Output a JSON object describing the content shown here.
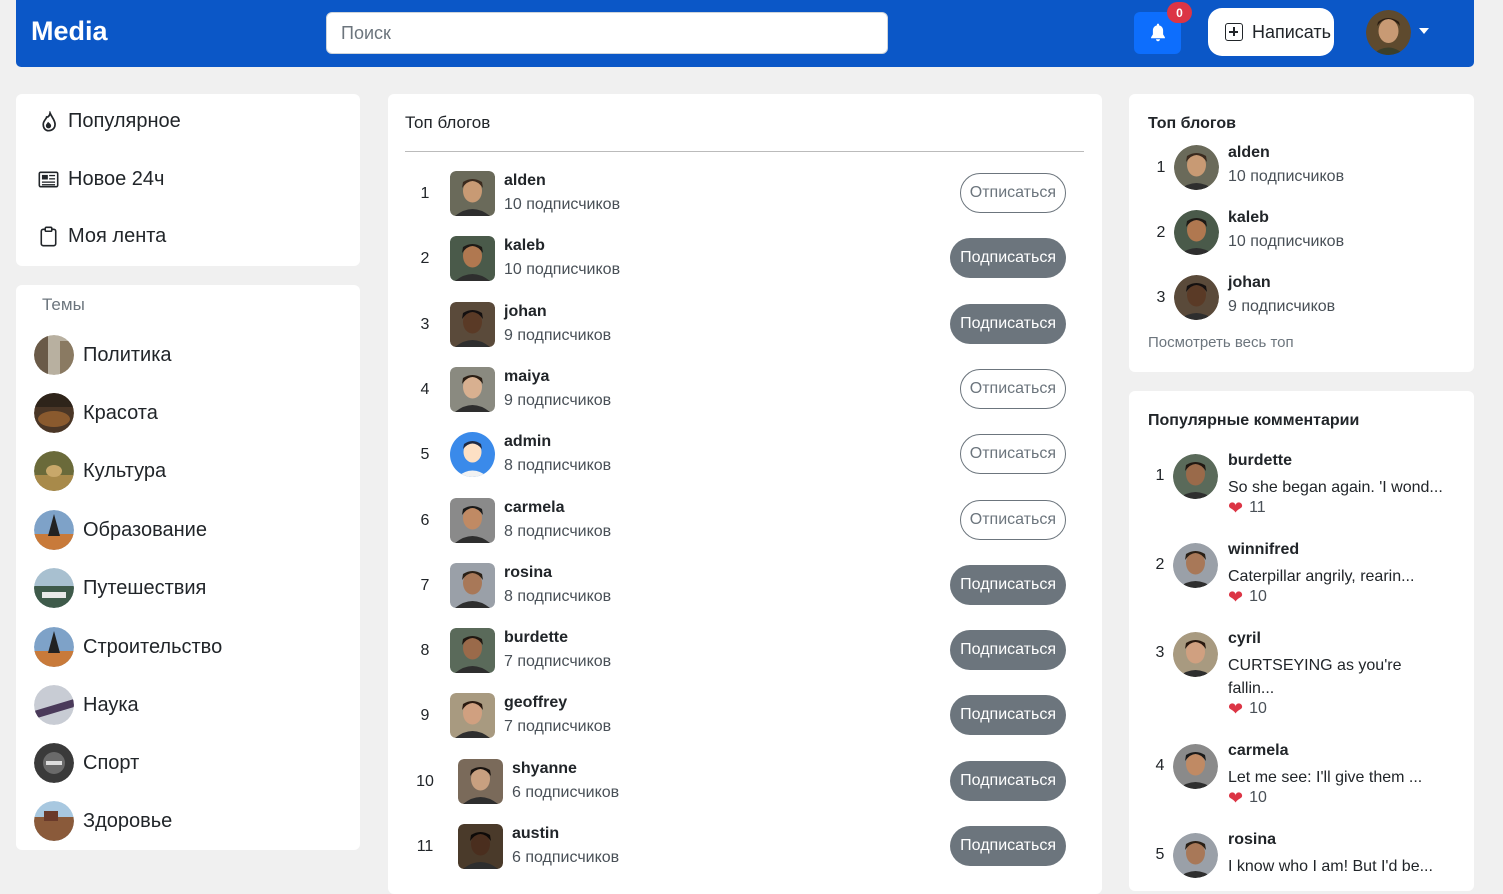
{
  "header": {
    "brand": "Media",
    "search_placeholder": "Поиск",
    "notifications_count": "0",
    "write_label": "Написать"
  },
  "nav": [
    {
      "label": "Популярное",
      "icon": "fire-icon"
    },
    {
      "label": "Новое 24ч",
      "icon": "newspaper-icon"
    },
    {
      "label": "Моя лента",
      "icon": "clipboard-icon"
    }
  ],
  "topics": {
    "title": "Темы",
    "items": [
      "Политика",
      "Красота",
      "Культура",
      "Образование",
      "Путешествия",
      "Строительство",
      "Наука",
      "Спорт",
      "Здоровье"
    ]
  },
  "top_blogs": {
    "title": "Топ блогов",
    "subscribe_label": "Подписаться",
    "unsubscribe_label": "Отписаться",
    "rows": [
      {
        "rank": "1",
        "name": "alden",
        "subs": "10 подписчиков",
        "subscribed": true
      },
      {
        "rank": "2",
        "name": "kaleb",
        "subs": "10 подписчиков",
        "subscribed": false
      },
      {
        "rank": "3",
        "name": "johan",
        "subs": "9 подписчиков",
        "subscribed": false
      },
      {
        "rank": "4",
        "name": "maiya",
        "subs": "9 подписчиков",
        "subscribed": true
      },
      {
        "rank": "5",
        "name": "admin",
        "subs": "8 подписчиков",
        "subscribed": true
      },
      {
        "rank": "6",
        "name": "carmela",
        "subs": "8 подписчиков",
        "subscribed": true
      },
      {
        "rank": "7",
        "name": "rosina",
        "subs": "8 подписчиков",
        "subscribed": false
      },
      {
        "rank": "8",
        "name": "burdette",
        "subs": "7 подписчиков",
        "subscribed": false
      },
      {
        "rank": "9",
        "name": "geoffrey",
        "subs": "7 подписчиков",
        "subscribed": false
      },
      {
        "rank": "10",
        "name": "shyanne",
        "subs": "6 подписчиков",
        "subscribed": false
      },
      {
        "rank": "11",
        "name": "austin",
        "subs": "6 подписчиков",
        "subscribed": false
      }
    ]
  },
  "sidebar_top": {
    "title": "Топ блогов",
    "rows": [
      {
        "rank": "1",
        "name": "alden",
        "subs": "10 подписчиков"
      },
      {
        "rank": "2",
        "name": "kaleb",
        "subs": "10 подписчиков"
      },
      {
        "rank": "3",
        "name": "johan",
        "subs": "9 подписчиков"
      }
    ],
    "see_all": "Посмотреть весь топ"
  },
  "popular_comments": {
    "title": "Популярные комментарии",
    "rows": [
      {
        "rank": "1",
        "name": "burdette",
        "text": "So she began again. 'I wond...",
        "likes": "11"
      },
      {
        "rank": "2",
        "name": "winnifred",
        "text": "Caterpillar angrily, rearin...",
        "likes": "10"
      },
      {
        "rank": "3",
        "name": "cyril",
        "text": "CURTSEYING as you're fallin...",
        "likes": "10"
      },
      {
        "rank": "4",
        "name": "carmela",
        "text": "Let me see: I'll give them ...",
        "likes": "10"
      },
      {
        "rank": "5",
        "name": "rosina",
        "text": "I know who I am! But I'd be...",
        "likes": ""
      }
    ]
  },
  "colors": {
    "brand_blue": "#0b57c7",
    "primary": "#0d6efd",
    "secondary": "#6c757d",
    "danger": "#dc3545",
    "background": "#f0f0f0"
  }
}
